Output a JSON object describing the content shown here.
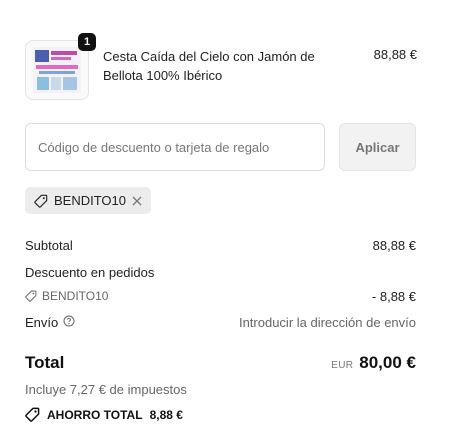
{
  "product": {
    "title": "Cesta Caída del Cielo con Jamón de Bellota 100% Ibérico",
    "price": "88,88 €",
    "quantity": "1"
  },
  "discount": {
    "placeholder": "Código de descuento o tarjeta de regalo",
    "value": "",
    "apply_label": "Aplicar",
    "applied_code": "BENDITO10"
  },
  "summary": {
    "subtotal_label": "Subtotal",
    "subtotal_value": "88,88 €",
    "order_discount_label": "Descuento en pedidos",
    "order_discount_code": "BENDITO10",
    "order_discount_value": "- 8,88 €",
    "shipping_label": "Envío",
    "shipping_value": "Introducir la dirección de envío",
    "total_label": "Total",
    "total_currency": "EUR",
    "total_value": "80,00 €",
    "tax_note": "Incluye 7,27 € de impuestos",
    "savings_label": "AHORRO TOTAL",
    "savings_value": "8,88 €"
  }
}
